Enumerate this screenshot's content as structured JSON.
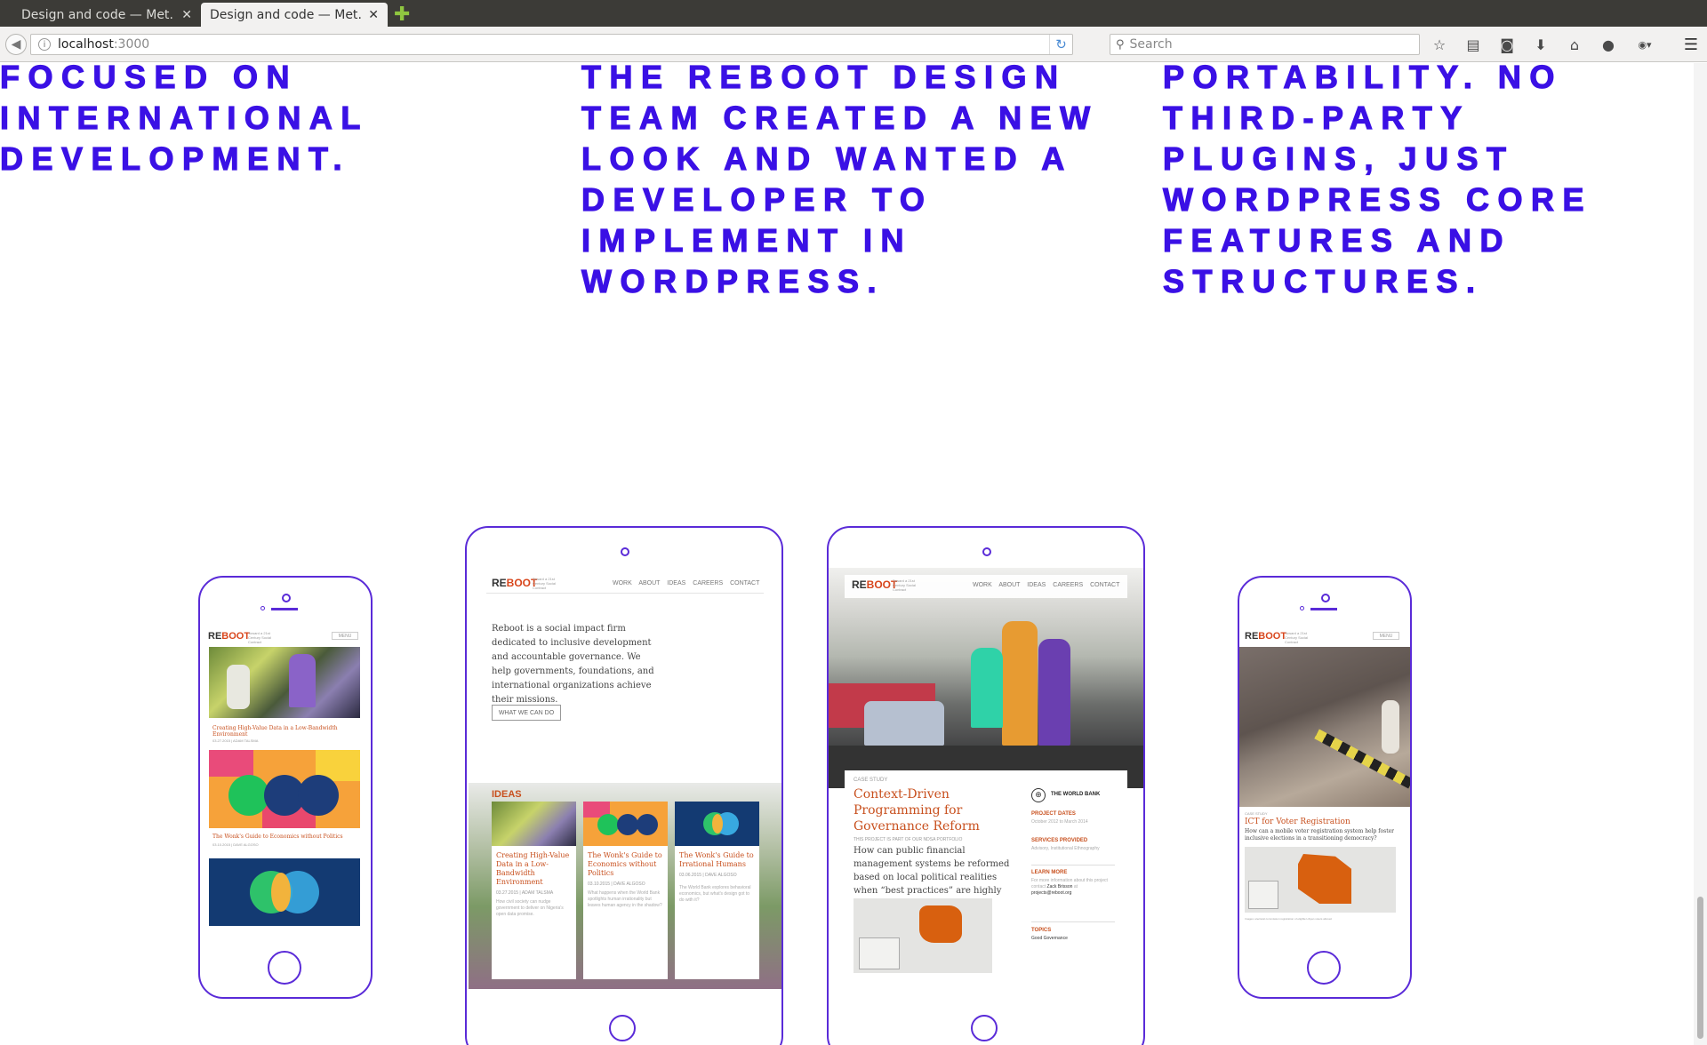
{
  "browser": {
    "tabs": [
      {
        "title": "Design and code — Met…",
        "active": false
      },
      {
        "title": "Design and code — Met…",
        "active": true
      }
    ],
    "url_host": "localhost",
    "url_port": ":3000",
    "search_placeholder": "Search",
    "icons": [
      "bookmark-star-icon",
      "reading-list-icon",
      "pocket-icon",
      "download-icon",
      "home-icon",
      "chat-icon",
      "adblock-icon",
      "menu-icon"
    ]
  },
  "page": {
    "columns": [
      "FOCUSED ON INTERNATIONAL DEVELOPMENT.",
      "THE REBOOT DESIGN TEAM CREATED A NEW LOOK AND WANTED A DEVELOPER TO IMPLEMENT IN WORDPRESS.",
      "PORTABILITY. NO THIRD-PARTY PLUGINS, JUST WORDPRESS CORE FEATURES AND STRUCTURES."
    ],
    "accent_color": "#3a10e5"
  },
  "devices": {
    "logo_re": "RE",
    "logo_boot": "BOOT",
    "tagline": "Toward a 21st Century Social Contract",
    "menu": "MENU",
    "nav": [
      "WORK",
      "ABOUT",
      "IDEAS",
      "CAREERS",
      "CONTACT"
    ],
    "phone1": {
      "card1_title": "Creating High-Value Data in a Low-Bandwidth Environment",
      "card1_meta": "03.27.2015 | ADAM TALSMA",
      "card2_title": "The Wonk's Guide to Economics without Politics",
      "card2_meta": "03.10.2015 | DAVE ALGOSO"
    },
    "tablet1": {
      "intro": "Reboot is a social impact firm dedicated to inclusive development and accountable governance. We help governments, foundations, and international organizations achieve their missions.",
      "cta": "WHAT WE CAN DO",
      "ideas_heading": "IDEAS",
      "cards": [
        {
          "title": "Creating High-Value Data in a Low-Bandwidth Environment",
          "meta": "03.27.2015 | ADAM TALSMA",
          "text": "How civil society can nudge government to deliver on Nigeria's open data promise."
        },
        {
          "title": "The Wonk's Guide to Economics without Politics",
          "meta": "03.10.2015 | DAVE ALGOSO",
          "text": "What happens when the World Bank spotlights human irrationality but leaves human agency in the shadow?"
        },
        {
          "title": "The Wonk's Guide to Irrational Humans",
          "meta": "03.06.2015 | DAVE ALGOSO",
          "text": "The World Bank explores behavioral economics, but what's design got to do with it?"
        }
      ]
    },
    "tablet2": {
      "label": "CASE STUDY",
      "title": "Context-Driven Programming for Governance Reform",
      "part_of": "THIS PROJECT IS PART OF OUR NDSA PORTFOLIO",
      "question": "How can public financial management systems be reformed based on local political realities when “best practices” are highly context-dependent?",
      "client": "THE WORLD BANK",
      "dates_label": "PROJECT DATES",
      "dates": "October 2012 to March 2014",
      "services_label": "SERVICES PROVIDED",
      "services": "Advisory, Institutional Ethnography",
      "learn_label": "LEARN MORE",
      "learn_text": "For more information about this project contact",
      "contact_name": "Zack Brisson",
      "contact_at": "at",
      "contact_email": "projects@reboot.org",
      "topics_label": "TOPICS",
      "topics": "Good Governance"
    },
    "phone2": {
      "label": "CASE STUDY",
      "title": "ICT for Voter Registration",
      "question": "How can a mobile voter registration system help foster inclusive elections in a transitioning democracy?",
      "footnote": "Images: electoral commission registration of eligible Libyan voters abroad."
    }
  }
}
